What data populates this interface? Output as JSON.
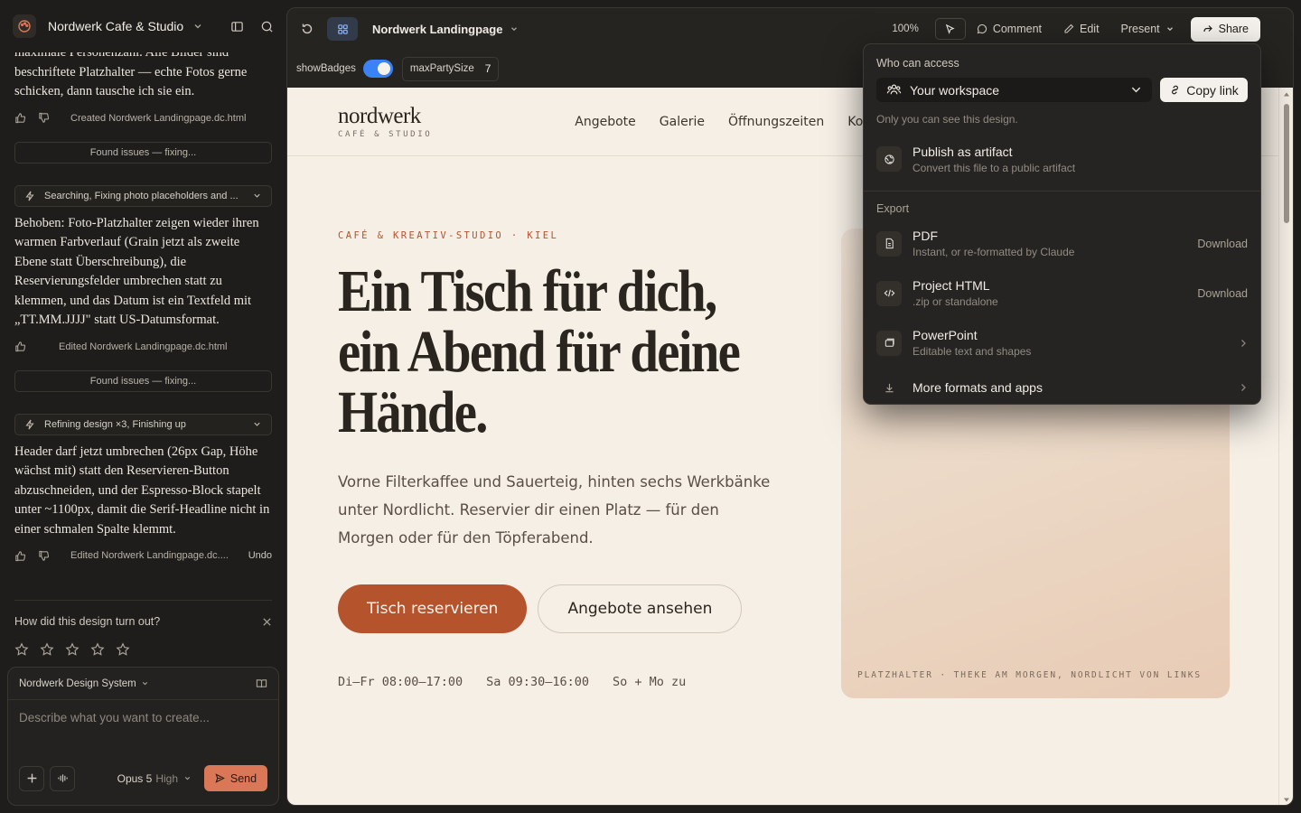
{
  "app": {
    "project_name": "Nordwerk Cafe & Studio"
  },
  "chat": {
    "messages": [
      {
        "text": "maximale Personenzahl. Alle Bilder sind beschriftete Platzhalter — echte Fotos gerne schicken, dann tausche ich sie ein.",
        "meta": "Created Nordwerk Landingpage.dc.html"
      },
      {
        "status": "Found issues — fixing...",
        "step": "Searching, Fixing photo placeholders and ...",
        "text": "Behoben: Foto-Platzhalter zeigen wieder ihren warmen Farbverlauf (Grain jetzt als zweite Ebene statt Überschreibung), die Reservierungsfelder umbrechen statt zu klemmen, und das Datum ist ein Textfeld mit „TT.MM.JJJJ\" statt US-Datumsformat.",
        "meta": "Edited Nordwerk Landingpage.dc.html"
      },
      {
        "status": "Found issues — fixing...",
        "step": "Refining design ×3, Finishing up",
        "text": "Header darf jetzt umbrechen (26px Gap, Höhe wächst mit) statt den Reservieren-Button abzuschneiden, und der Espresso-Block stapelt unter ~1100px, damit die Serif-Headline nicht in einer schmalen Spalte klemmt.",
        "meta": "Edited Nordwerk Landingpage.dc....",
        "undo": "Undo"
      }
    ],
    "rating_question": "How did this design turn out?"
  },
  "composer": {
    "design_system": "Nordwerk Design System",
    "placeholder": "Describe what you want to create...",
    "model": "Opus 5",
    "effort": "High",
    "send_label": "Send"
  },
  "toolbar": {
    "file_title": "Nordwerk Landingpage",
    "zoom": "100%",
    "comment_label": "Comment",
    "edit_label": "Edit",
    "present_label": "Present",
    "share_label": "Share"
  },
  "tweaks": {
    "show_badges_label": "showBadges",
    "show_badges_on": true,
    "max_party_label": "maxPartySize",
    "max_party_value": "7"
  },
  "site": {
    "brand_name": "nordwerk",
    "brand_sub": "CAFÉ & STUDIO",
    "nav": [
      "Angebote",
      "Galerie",
      "Öffnungszeiten",
      "Kontakt"
    ],
    "eyebrow": "CAFÉ & KREATIV-STUDIO · KIEL",
    "headline": [
      "Ein Tisch für dich,",
      "ein Abend für deine",
      "Hände."
    ],
    "lead": "Vorne Filterkaffee und Sauerteig, hinten sechs Werkbänke unter Nordlicht. Reservier dir einen Platz — für den Morgen oder für den Töpferabend.",
    "cta_primary": "Tisch reservieren",
    "cta_secondary": "Angebote ansehen",
    "hours": [
      "Di–Fr 08:00–17:00",
      "Sa 09:30–16:00",
      "So + Mo zu"
    ],
    "photo_caption": "PLATZHALTER · THEKE AM MORGEN, NORDLICHT VON LINKS"
  },
  "share_menu": {
    "access_label": "Who can access",
    "access_value": "Your workspace",
    "copy_link": "Copy link",
    "access_note": "Only you can see this design.",
    "publish_title": "Publish as artifact",
    "publish_sub": "Convert this file to a public artifact",
    "export_label": "Export",
    "exports": [
      {
        "title": "PDF",
        "sub": "Instant, or re-formatted by Claude",
        "action": "Download"
      },
      {
        "title": "Project HTML",
        "sub": ".zip or standalone",
        "action": "Download"
      },
      {
        "title": "PowerPoint",
        "sub": "Editable text and shapes",
        "action": ""
      },
      {
        "title": "More formats and apps",
        "sub": "",
        "action": ""
      }
    ]
  },
  "colors": {
    "accent": "#d97757",
    "site_bg": "#f5efe6",
    "brand_terracotta": "#b5532d",
    "toggle_blue": "#3b82f6"
  }
}
